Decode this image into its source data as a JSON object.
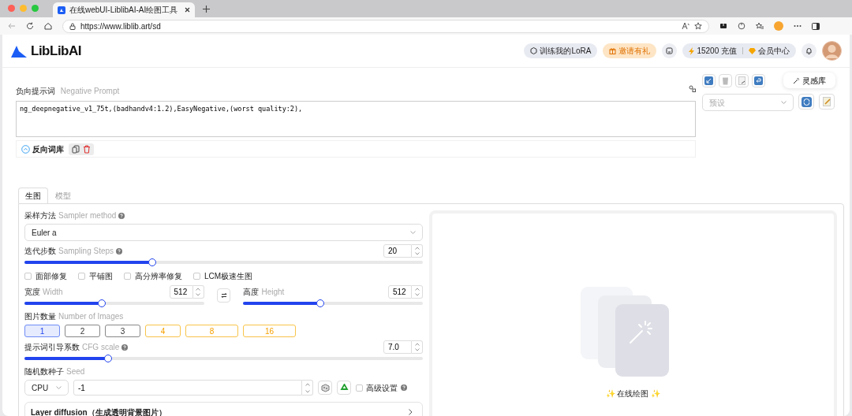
{
  "browser": {
    "tab_title": "在线webUI-LiblibAI-AI绘图工具",
    "url": "https://www.liblib.art/sd"
  },
  "header": {
    "logo": "LibLibAI",
    "train_button": "训练我的LoRA",
    "invite_button": "邀请有礼",
    "credits": "15200 充值",
    "member_center": "会员中心"
  },
  "negative_prompt": {
    "label": "负向提示词",
    "label_en": "Negative Prompt",
    "value": "ng_deepnegative_v1_75t,(badhandv4:1.2),EasyNegative,(worst quality:2),",
    "library": "反向词库"
  },
  "right_panel": {
    "inspiration": "灵感库",
    "preset_placeholder": "预设"
  },
  "tabs": [
    {
      "label": "生图",
      "selected": true
    },
    {
      "label": "模型",
      "selected": false
    }
  ],
  "sampler": {
    "label": "采样方法",
    "label_en": "Sampler method",
    "value": "Euler a"
  },
  "steps": {
    "label": "迭代步数",
    "label_en": "Sampling Steps",
    "value": "20",
    "level": 0.32
  },
  "options": [
    {
      "label": "面部修复",
      "checked": false
    },
    {
      "label": "平铺图",
      "checked": false
    },
    {
      "label": "高分辨率修复",
      "checked": false
    },
    {
      "label": "LCM极速生图",
      "checked": false
    }
  ],
  "width": {
    "label": "宽度",
    "label_en": "Width",
    "value": "512",
    "level": 0.43
  },
  "height": {
    "label": "高度",
    "label_en": "Height",
    "value": "512",
    "level": 0.43
  },
  "images": {
    "label": "图片数量",
    "label_en": "Number of Images",
    "choices": [
      {
        "label": "1",
        "selected": true,
        "kind": "free"
      },
      {
        "label": "2",
        "selected": false,
        "kind": "free"
      },
      {
        "label": "3",
        "selected": false,
        "kind": "free"
      },
      {
        "label": "4",
        "selected": false,
        "kind": "member"
      },
      {
        "label": "8",
        "selected": false,
        "kind": "member"
      },
      {
        "label": "16",
        "selected": false,
        "kind": "member"
      }
    ]
  },
  "cfg": {
    "label": "提示词引导系数",
    "label_en": "CFG scale",
    "value": "7.0",
    "level": 0.21
  },
  "seed": {
    "label": "随机数种子",
    "label_en": "Seed",
    "device": "CPU",
    "value": "-1",
    "advanced": "高级设置",
    "advanced_checked": false
  },
  "layer_diffusion": "Layer diffusion（生成透明背景图片）",
  "preview": {
    "caption": "✨ 在线绘图 ✨"
  }
}
